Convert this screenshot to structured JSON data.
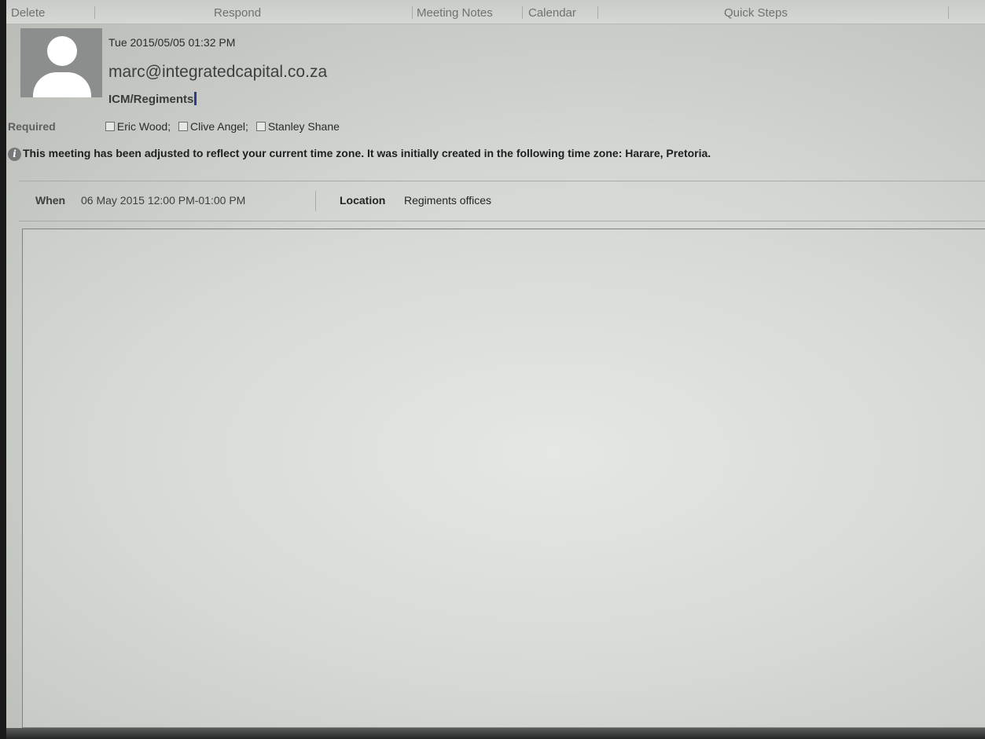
{
  "ribbon": {
    "groups": [
      "Delete",
      "Respond",
      "Meeting Notes",
      "Calendar",
      "Quick Steps"
    ]
  },
  "header": {
    "sent_date": "Tue 2015/05/05 01:32 PM",
    "sender": "marc@integratedcapital.co.za",
    "subject": "ICM/Regiments"
  },
  "required": {
    "label": "Required",
    "attendees": [
      "Eric Wood;",
      "Clive Angel;",
      "Stanley Shane"
    ]
  },
  "info": {
    "icon": "info-icon",
    "message": "This meeting has been adjusted to reflect your current time zone. It was initially created in the following time zone: Harare, Pretoria."
  },
  "meeting": {
    "when_label": "When",
    "when_value": "06 May 2015 12:00 PM-01:00 PM",
    "location_label": "Location",
    "location_value": "Regiments offices"
  }
}
